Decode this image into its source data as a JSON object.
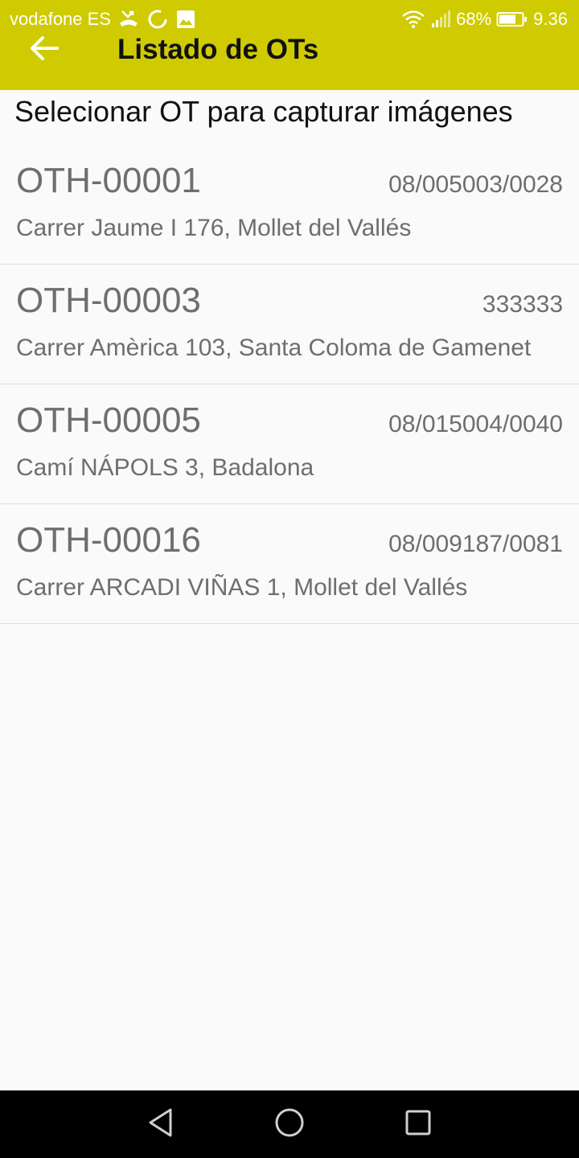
{
  "status_bar": {
    "carrier": "vodafone ES",
    "battery": "68%",
    "time": "9.36",
    "icons": [
      "missed-call-icon",
      "sync-icon",
      "image-icon",
      "wifi-icon",
      "signal-icon",
      "battery-icon"
    ]
  },
  "toolbar": {
    "back_icon": "arrow-back-icon",
    "title": "Listado de OTs"
  },
  "subheader": "Selecionar OT para capturar imágenes",
  "ots": [
    {
      "id": "OTH-00001",
      "ref": "08/005003/0028",
      "address": "Carrer Jaume I 176, Mollet del Vallés"
    },
    {
      "id": "OTH-00003",
      "ref": "333333",
      "address": "Carrer Amèrica 103, Santa Coloma de Gamenet"
    },
    {
      "id": "OTH-00005",
      "ref": "08/015004/0040",
      "address": "Camí NÁPOLS 3, Badalona"
    },
    {
      "id": "OTH-00016",
      "ref": "08/009187/0081",
      "address": "Carrer ARCADI VIÑAS 1, Mollet del Vallés"
    }
  ],
  "nav": [
    "back-triangle-icon",
    "home-circle-icon",
    "recents-square-icon"
  ],
  "colors": {
    "appbar": "#cfcb00",
    "background": "#fafafa",
    "row_text": "#6e6e6e",
    "divider": "#dcdcdc"
  }
}
